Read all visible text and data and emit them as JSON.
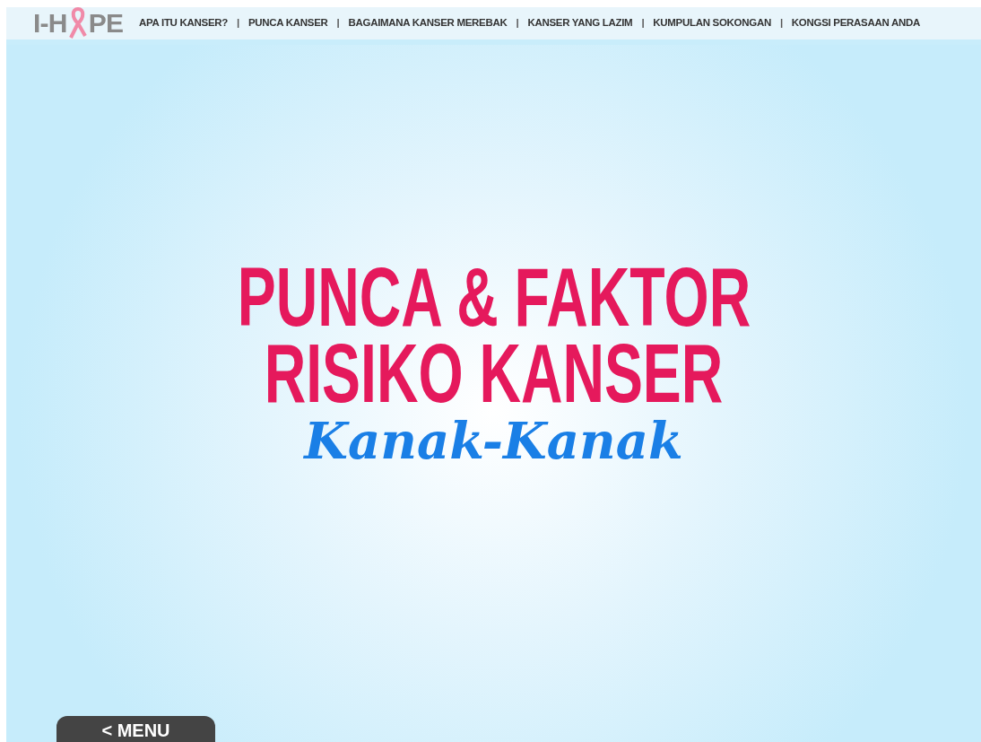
{
  "logo": {
    "left": "I-H",
    "right": "PE"
  },
  "nav": {
    "separator": "|",
    "items": [
      {
        "label": "APA ITU KANSER?"
      },
      {
        "label": "PUNCA KANSER"
      },
      {
        "label": "BAGAIMANA KANSER MEREBAK"
      },
      {
        "label": "KANSER YANG LAZIM"
      },
      {
        "label": "KUMPULAN SOKONGAN"
      },
      {
        "label": "KONGSI PERASAAN ANDA"
      }
    ]
  },
  "title": {
    "lines": [
      "PUNCA & FAKTOR",
      "RISIKO KANSER"
    ],
    "subtitle": "Kanak-Kanak"
  },
  "menu_button": {
    "label": "< MENU"
  }
}
